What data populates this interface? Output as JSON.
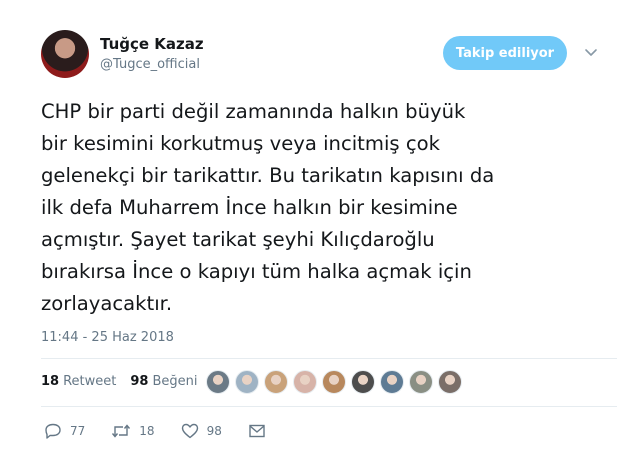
{
  "author": {
    "name": "Tuğçe Kazaz",
    "handle": "@Tugce_official"
  },
  "follow_button": {
    "label": "Takip ediliyor",
    "color": "#71c9f8"
  },
  "tweet": {
    "lines": [
      "CHP bir parti değil zamanında halkın büyük",
      "bir kesimini korkutmuş veya incitmiş çok",
      "gelenekçi bir tarikattır. Bu tarikatın kapısını da",
      "ilk defa Muharrem İnce halkın bir kesimine",
      "açmıştır. Şayet tarikat şeyhi Kılıçdaroğlu",
      "bırakırsa İnce o kapıyı tüm halka açmak için",
      "zorlayacaktır."
    ],
    "timestamp": "11:44 - 25 Haz 2018"
  },
  "stats": {
    "retweet_count": "18",
    "retweet_label": "Retweet",
    "like_count": "98",
    "like_label": "Beğeni"
  },
  "likers": [
    {
      "name": "liker-avatar-1",
      "color": "#6b7a86"
    },
    {
      "name": "liker-avatar-2",
      "color": "#9fb3c4"
    },
    {
      "name": "liker-avatar-3",
      "color": "#c9a27a"
    },
    {
      "name": "liker-avatar-4",
      "color": "#d7b3a8"
    },
    {
      "name": "liker-avatar-5",
      "color": "#b8885d"
    },
    {
      "name": "liker-avatar-6",
      "color": "#4d4d4d"
    },
    {
      "name": "liker-avatar-7",
      "color": "#5e7b94"
    },
    {
      "name": "liker-avatar-8",
      "color": "#8a8f84"
    },
    {
      "name": "liker-avatar-9",
      "color": "#7a6e68"
    }
  ],
  "actions": {
    "reply_count": "77",
    "retweet_count": "18",
    "like_count": "98"
  },
  "icons": {
    "reply": "reply-icon",
    "retweet": "retweet-icon",
    "like": "heart-icon",
    "message": "envelope-icon",
    "more": "chevron-down-icon"
  }
}
